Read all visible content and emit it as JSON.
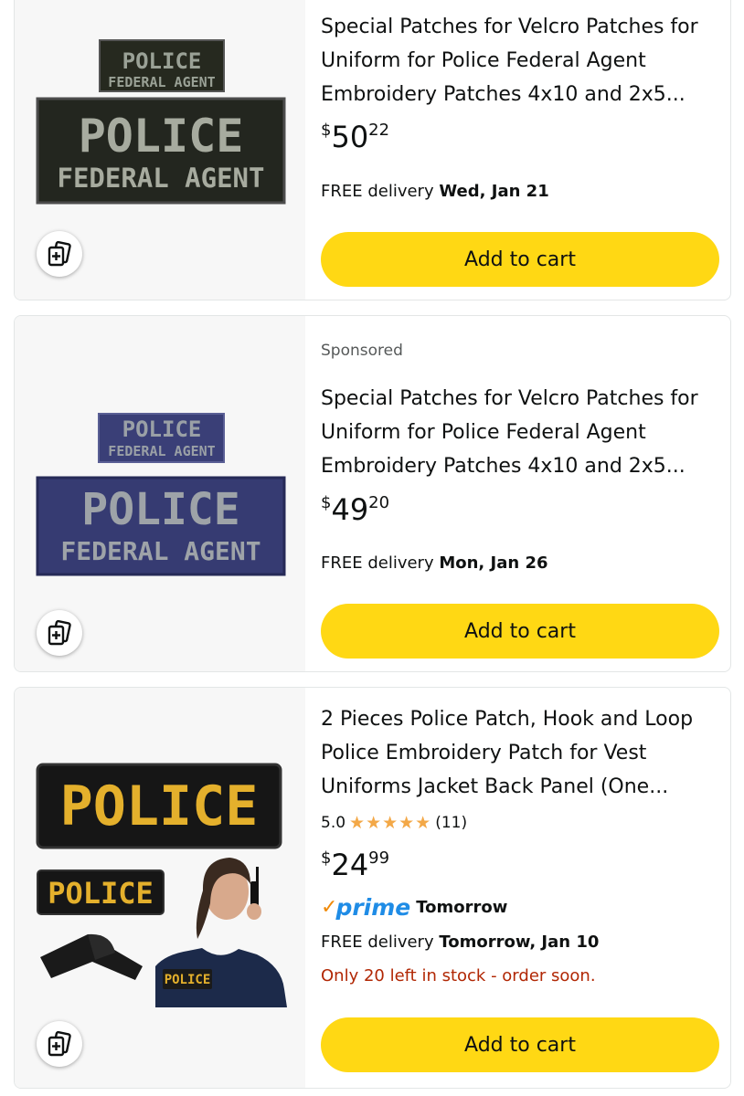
{
  "products": [
    {
      "title": "Special Patches for Velcro Patches for Uniform for Police Federal Agent Embroidery Patches 4x10 and 2x5...",
      "price": {
        "symbol": "$",
        "whole": "50",
        "fraction": "22"
      },
      "delivery": {
        "prefix": "FREE delivery ",
        "date": "Wed, Jan 21"
      },
      "cart_label": "Add to cart",
      "patch_text": {
        "line1": "POLICE",
        "line2": "FEDERAL AGENT"
      }
    },
    {
      "sponsored": "Sponsored",
      "title": "Special Patches for Velcro Patches for Uniform for Police Federal Agent Embroidery Patches 4x10 and 2x5...",
      "price": {
        "symbol": "$",
        "whole": "49",
        "fraction": "20"
      },
      "delivery": {
        "prefix": "FREE delivery ",
        "date": "Mon, Jan 26"
      },
      "cart_label": "Add to cart",
      "patch_text": {
        "line1": "POLICE",
        "line2": "FEDERAL AGENT"
      }
    },
    {
      "title": "2 Pieces Police Patch, Hook and Loop Police Embroidery Patch for Vest Uniforms Jacket Back Panel (One...",
      "rating": {
        "value": "5.0",
        "stars": 5,
        "count": "(11)"
      },
      "price": {
        "symbol": "$",
        "whole": "24",
        "fraction": "99"
      },
      "prime": {
        "logo": "prime",
        "when": "Tomorrow"
      },
      "delivery": {
        "prefix": "FREE delivery ",
        "date": "Tomorrow, Jan 10"
      },
      "stock": "Only 20 left in stock - order soon.",
      "cart_label": "Add to cart",
      "patch_text": {
        "line1": "POLICE"
      }
    }
  ],
  "icons": {
    "compare": "compare-add-icon",
    "star": "star-icon",
    "prime_check": "prime-check-icon"
  },
  "colors": {
    "cart_button": "#ffd814",
    "stock_warning": "#b12704",
    "star": "#f3a847",
    "prime": "#1f8ce6"
  }
}
